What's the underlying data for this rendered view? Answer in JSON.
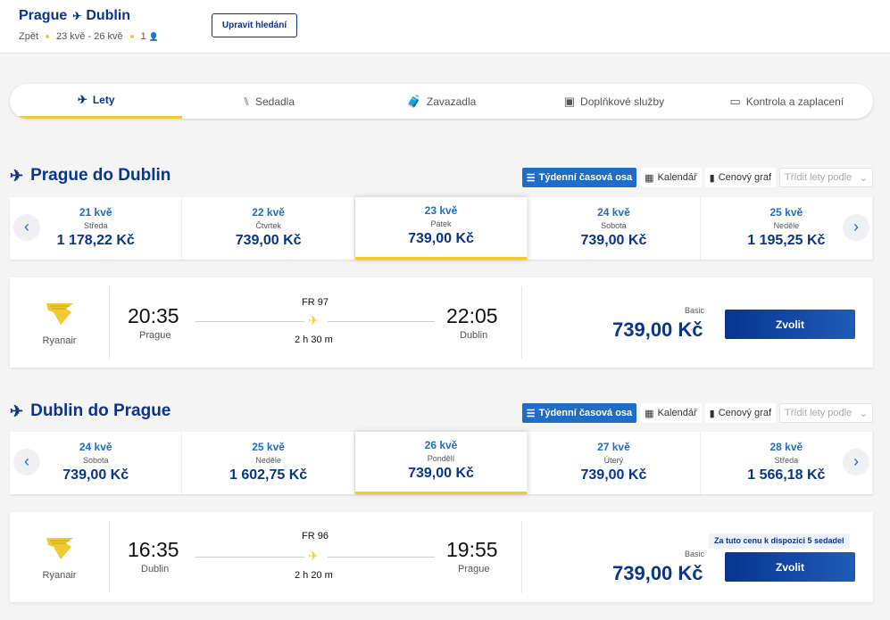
{
  "header": {
    "origin": "Prague",
    "destination": "Dublin",
    "back_label": "Zpět",
    "dates": "23 kvě - 26 kvě",
    "pax_count": "1",
    "edit_label": "Upravit hledání"
  },
  "steps": [
    {
      "label": "Lety",
      "icon": "plane-icon",
      "active": true
    },
    {
      "label": "Sedadla",
      "icon": "seat-icon",
      "active": false
    },
    {
      "label": "Zavazadla",
      "icon": "luggage-icon",
      "active": false
    },
    {
      "label": "Doplňkové služby",
      "icon": "bus-icon",
      "active": false
    },
    {
      "label": "Kontrola a zaplacení",
      "icon": "card-icon",
      "active": false
    }
  ],
  "tools": {
    "weekly": "Týdenní časová osa",
    "calendar": "Kalendář",
    "price_graph": "Cenový graf",
    "sort_placeholder": "Třídit lety podle"
  },
  "outbound": {
    "title": "Prague do Dublin",
    "dates": [
      {
        "date": "21 kvě",
        "day": "Středa",
        "price": "1 178,22 Kč",
        "selected": false
      },
      {
        "date": "22 kvě",
        "day": "Čtvrtek",
        "price": "739,00 Kč",
        "selected": false
      },
      {
        "date": "23 kvě",
        "day": "Pátek",
        "price": "739,00 Kč",
        "selected": true
      },
      {
        "date": "24 kvě",
        "day": "Sobota",
        "price": "739,00 Kč",
        "selected": false
      },
      {
        "date": "25 kvě",
        "day": "Neděle",
        "price": "1 195,25 Kč",
        "selected": false
      }
    ],
    "flight": {
      "airline": "Ryanair",
      "dep_time": "20:35",
      "dep_city": "Prague",
      "arr_time": "22:05",
      "arr_city": "Dublin",
      "flight_no": "FR 97",
      "duration": "2 h 30 m",
      "fare_type": "Basic",
      "price": "739,00 Kč",
      "select_label": "Zvolit"
    }
  },
  "inbound": {
    "title": "Dublin do Prague",
    "dates": [
      {
        "date": "24 kvě",
        "day": "Sobota",
        "price": "739,00 Kč",
        "selected": false
      },
      {
        "date": "25 kvě",
        "day": "Neděle",
        "price": "1 602,75 Kč",
        "selected": false
      },
      {
        "date": "26 kvě",
        "day": "Pondělí",
        "price": "739,00 Kč",
        "selected": true
      },
      {
        "date": "27 kvě",
        "day": "Úterý",
        "price": "739,00 Kč",
        "selected": false
      },
      {
        "date": "28 kvě",
        "day": "Středa",
        "price": "1 566,18 Kč",
        "selected": false
      }
    ],
    "flight": {
      "airline": "Ryanair",
      "dep_time": "16:35",
      "dep_city": "Dublin",
      "arr_time": "19:55",
      "arr_city": "Prague",
      "flight_no": "FR 96",
      "duration": "2 h 20 m",
      "fare_type": "Basic",
      "price": "739,00 Kč",
      "select_label": "Zvolit",
      "seat_badge": "Za tuto cenu k dispozici 5 sedadel"
    }
  },
  "colors": {
    "brand_blue": "#073590",
    "accent_blue": "#1f6dc8",
    "accent_yellow": "#f1c933"
  }
}
